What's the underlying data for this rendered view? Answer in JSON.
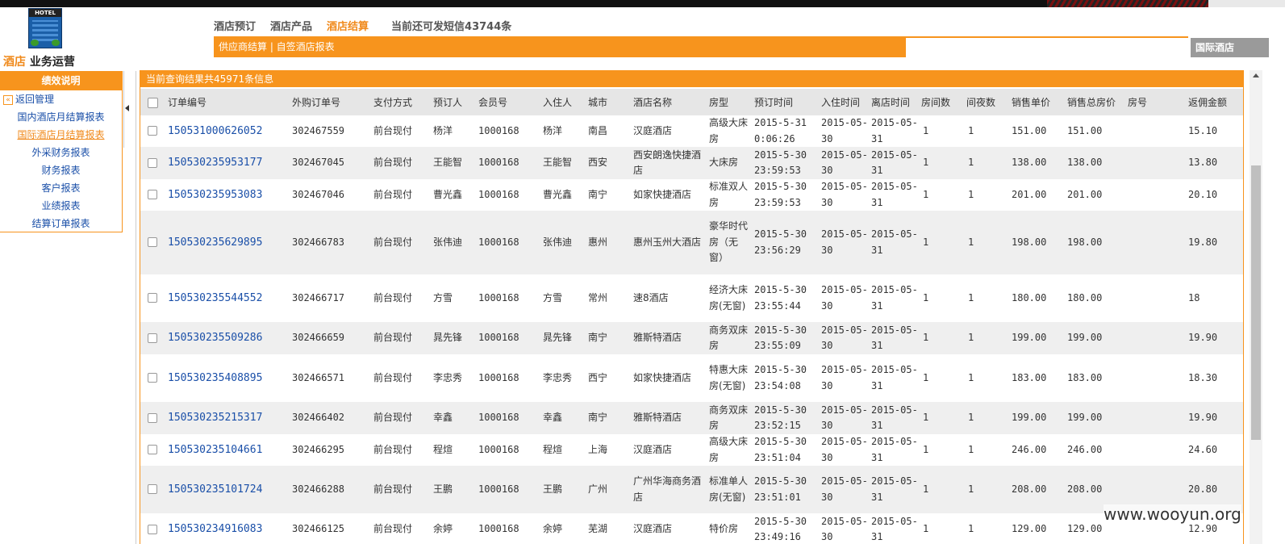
{
  "logo": {
    "sign_text": "HOTEL",
    "title_orange": "酒店",
    "title_black": "业务运营"
  },
  "topnav": {
    "items": [
      "酒店预订",
      "酒店产品",
      "酒店结算"
    ],
    "active_index": 2,
    "sms_text": "当前还可发短信43744条"
  },
  "subnav": {
    "text": "供应商结算 | 自签酒店报表",
    "tab": "国际酒店"
  },
  "sidebar": {
    "header": "绩效说明",
    "back": "返回管理",
    "items": [
      "国内酒店月结算报表",
      "国际酒店月结算报表",
      "外采财务报表",
      "财务报表",
      "客户报表",
      "业绩报表",
      "结算订单报表"
    ],
    "active_index": 1
  },
  "results": {
    "summary": "当前查询结果共45971条信息",
    "columns": [
      "订单编号",
      "外购订单号",
      "支付方式",
      "预订人",
      "会员号",
      "入住人",
      "城市",
      "酒店名称",
      "房型",
      "预订时间",
      "入住时间",
      "离店时间",
      "房间数",
      "间夜数",
      "销售单价",
      "销售总房价",
      "房号",
      "返佣金额"
    ],
    "rows": [
      [
        "150531000626052",
        "302467559",
        "前台现付",
        "杨洋",
        "1000168",
        "杨洋",
        "南昌",
        "汉庭酒店",
        "高级大床房",
        "2015-5-31 0:06:26",
        "2015-05-30",
        "2015-05-31",
        "1",
        "1",
        "151.00",
        "151.00",
        "",
        "15.10"
      ],
      [
        "150530235953177",
        "302467045",
        "前台现付",
        "王能智",
        "1000168",
        "王能智",
        "西安",
        "西安朗逸快捷酒店",
        "大床房",
        "2015-5-30 23:59:53",
        "2015-05-30",
        "2015-05-31",
        "1",
        "1",
        "138.00",
        "138.00",
        "",
        "13.80"
      ],
      [
        "150530235953083",
        "302467046",
        "前台现付",
        "曹光鑫",
        "1000168",
        "曹光鑫",
        "南宁",
        "如家快捷酒店",
        "标准双人房",
        "2015-5-30 23:59:53",
        "2015-05-30",
        "2015-05-31",
        "1",
        "1",
        "201.00",
        "201.00",
        "",
        "20.10"
      ],
      [
        "150530235629895",
        "302466783",
        "前台现付",
        "张伟迪",
        "1000168",
        "张伟迪",
        "惠州",
        "惠州玉州大酒店",
        "豪华时代房（无窗）",
        "2015-5-30 23:56:29",
        "2015-05-30",
        "2015-05-31",
        "1",
        "1",
        "198.00",
        "198.00",
        "",
        "19.80"
      ],
      [
        "150530235544552",
        "302466717",
        "前台现付",
        "方雪",
        "1000168",
        "方雪",
        "常州",
        "速8酒店",
        "经济大床房(无窗)",
        "2015-5-30 23:55:44",
        "2015-05-30",
        "2015-05-31",
        "1",
        "1",
        "180.00",
        "180.00",
        "",
        "18"
      ],
      [
        "150530235509286",
        "302466659",
        "前台现付",
        "晁先锋",
        "1000168",
        "晁先锋",
        "南宁",
        "雅斯特酒店",
        "商务双床房",
        "2015-5-30 23:55:09",
        "2015-05-30",
        "2015-05-31",
        "1",
        "1",
        "199.00",
        "199.00",
        "",
        "19.90"
      ],
      [
        "150530235408895",
        "302466571",
        "前台现付",
        "李忠秀",
        "1000168",
        "李忠秀",
        "西宁",
        "如家快捷酒店",
        "特惠大床房(无窗)",
        "2015-5-30 23:54:08",
        "2015-05-30",
        "2015-05-31",
        "1",
        "1",
        "183.00",
        "183.00",
        "",
        "18.30"
      ],
      [
        "150530235215317",
        "302466402",
        "前台现付",
        "幸鑫",
        "1000168",
        "幸鑫",
        "南宁",
        "雅斯特酒店",
        "商务双床房",
        "2015-5-30 23:52:15",
        "2015-05-30",
        "2015-05-31",
        "1",
        "1",
        "199.00",
        "199.00",
        "",
        "19.90"
      ],
      [
        "150530235104661",
        "302466295",
        "前台现付",
        "程煊",
        "1000168",
        "程煊",
        "上海",
        "汉庭酒店",
        "高级大床房",
        "2015-5-30 23:51:04",
        "2015-05-30",
        "2015-05-31",
        "1",
        "1",
        "246.00",
        "246.00",
        "",
        "24.60"
      ],
      [
        "150530235101724",
        "302466288",
        "前台现付",
        "王鹏",
        "1000168",
        "王鹏",
        "广州",
        "广州华海商务酒店",
        "标准单人房(无窗)",
        "2015-5-30 23:51:01",
        "2015-05-30",
        "2015-05-31",
        "1",
        "1",
        "208.00",
        "208.00",
        "",
        "20.80"
      ],
      [
        "150530234916083",
        "302466125",
        "前台现付",
        "余婷",
        "1000168",
        "余婷",
        "芜湖",
        "汉庭酒店",
        "特价房",
        "2015-5-30 23:49:16",
        "2015-05-30",
        "2015-05-31",
        "1",
        "1",
        "129.00",
        "129.00",
        "",
        "12.90"
      ]
    ]
  },
  "watermark": "www.wooyun.org",
  "colors": {
    "accent": "#f7941d",
    "link": "#1a4fa8"
  }
}
